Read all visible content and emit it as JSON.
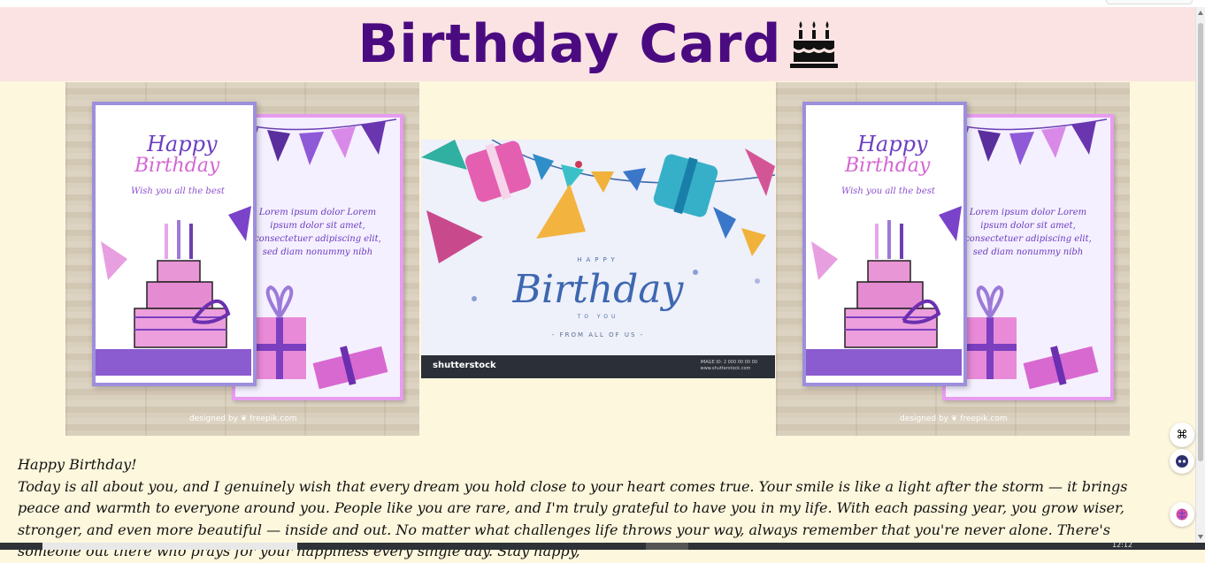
{
  "header": {
    "title": "Birthday Card"
  },
  "cards": {
    "happy": "Happy",
    "birthday": "Birthday",
    "wish": "Wish you all the best",
    "lorem": "Lorem ipsum dolor Lorem ipsum dolor sit amet, consectetuer adipiscing elit, sed diam nonummy nibh",
    "credit": "designed by ❦ freepik.com"
  },
  "center_image": {
    "happy": "HAPPY",
    "birthday": "Birthday",
    "to_you": "TO YOU",
    "from": "- FROM ALL OF US -",
    "brand": "shutterstock",
    "image_id": "IMAGE ID: 2 000 00 00 00",
    "site": "www.shutterstock.com"
  },
  "message": {
    "greeting": "Happy Birthday!",
    "body": "Today is all about you, and I genuinely wish that every dream you hold close to your heart comes true. Your smile is like a light after the storm — it brings peace and warmth to everyone around you. People like you are rare, and I'm truly grateful to have you in my life. With each passing year, you grow wiser, stronger, and even more beautiful — inside and out. No matter what challenges life throws your way, always remember that you're never alone. There's someone out there who prays for your happiness every single day. Stay happy,"
  },
  "colors": {
    "header_bg": "#fbe3e3",
    "title": "#4b0b80",
    "page_bg": "#fdf7dd"
  },
  "icons": [
    "birthday-cake-icon",
    "grid-icon",
    "robot-icon",
    "brain-icon"
  ],
  "taskbar": {
    "time": "12:12"
  }
}
